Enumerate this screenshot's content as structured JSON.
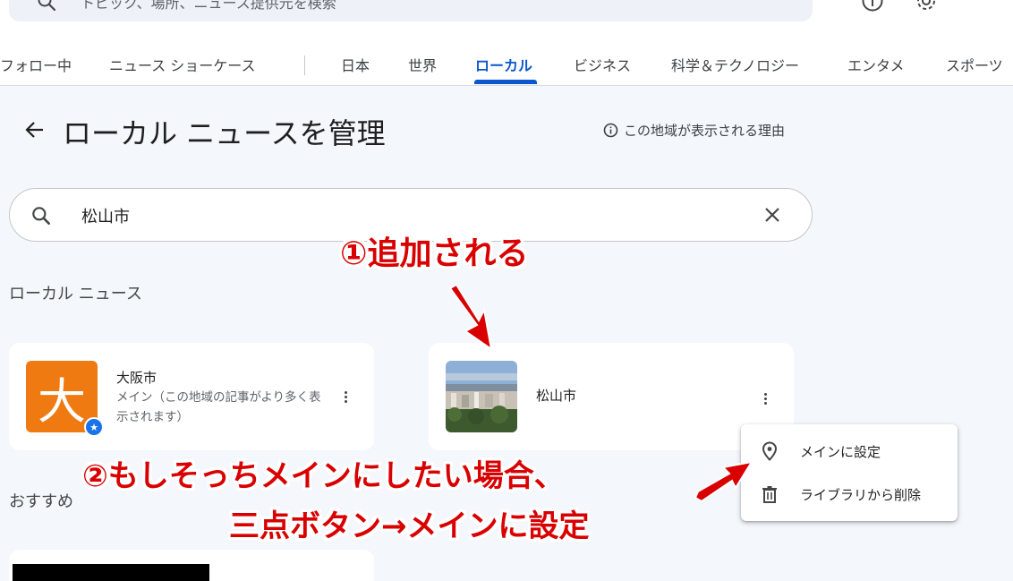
{
  "header": {
    "search_placeholder": "トピック、場所、ニュース提供元を検索",
    "icons": [
      "help-icon",
      "settings-icon"
    ]
  },
  "tabs": [
    {
      "label": "フォロー中"
    },
    {
      "label": "ニュース ショーケース"
    },
    {
      "label": "日本"
    },
    {
      "label": "世界"
    },
    {
      "label": "ローカル",
      "active": true
    },
    {
      "label": "ビジネス"
    },
    {
      "label": "科学＆テクノロジー"
    },
    {
      "label": "エンタメ"
    },
    {
      "label": "スポーツ"
    }
  ],
  "page": {
    "title": "ローカル ニュースを管理",
    "why_link": "この地域が表示される理由"
  },
  "location_search": {
    "value": "松山市"
  },
  "local_news": {
    "label": "ローカル ニュース",
    "cards": [
      {
        "name": "大阪市",
        "thumb_char": "大",
        "desc": "メイン（この地域の記事がより多く表示されます）",
        "main": true
      },
      {
        "name": "松山市",
        "desc": ""
      }
    ]
  },
  "context_menu": {
    "items": [
      {
        "label": "メインに設定",
        "icon": "location-pin-icon"
      },
      {
        "label": "ライブラリから削除",
        "icon": "trash-icon"
      }
    ]
  },
  "recommended": {
    "label": "おすすめ"
  },
  "annotations": {
    "added": "①追加される",
    "step2_line1": "②もしそっちメインにしたい場合、",
    "step2_line2": "三点ボタン→メインに設定"
  },
  "colors": {
    "accent": "#0b57d0",
    "annotation": "#d90000",
    "osaka_thumb": "#f07a12"
  }
}
